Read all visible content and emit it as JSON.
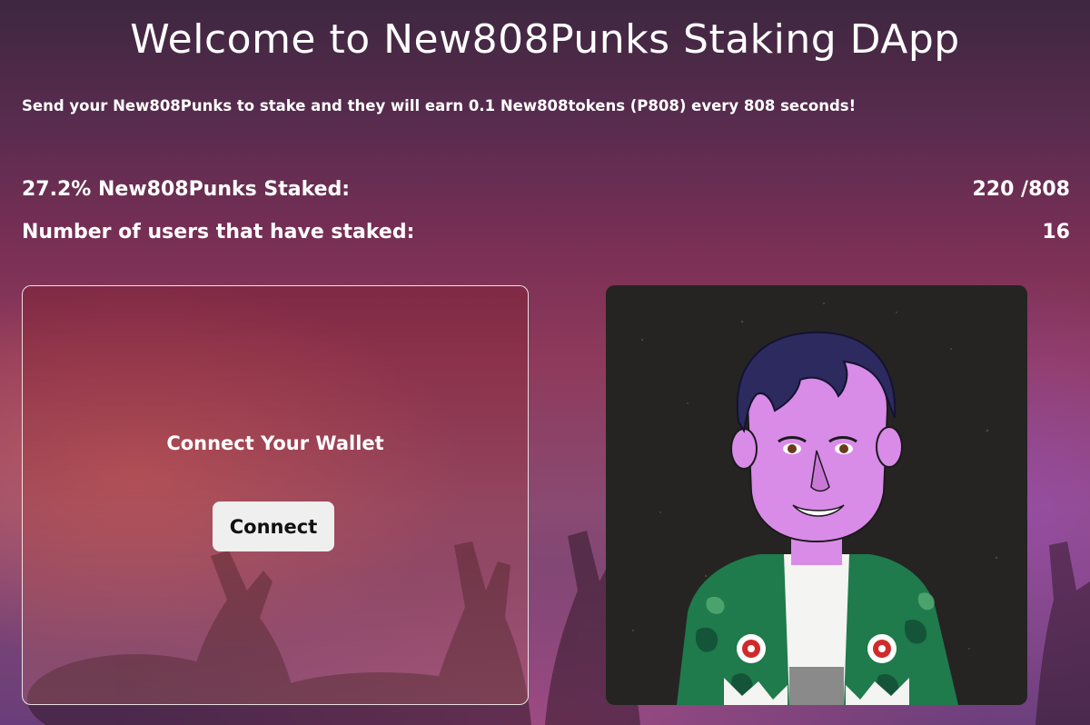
{
  "header": {
    "title": "Welcome to New808Punks Staking DApp",
    "subtitle": "Send your New808Punks to stake and they will earn 0.1 New808tokens (P808) every 808 seconds!"
  },
  "stats": {
    "staked_label": "27.2% New808Punks Staked:",
    "staked_value": "220 /808",
    "users_label": "Number of users that have staked:",
    "users_value": "16"
  },
  "wallet_panel": {
    "heading": "Connect Your Wallet",
    "button_label": "Connect"
  },
  "nft_image": {
    "alt": "New808Punks character avatar"
  },
  "colors": {
    "background_top": "#3e2740",
    "background_mid": "#8e3a5c",
    "button_bg": "#efefef",
    "nft_bg": "#252423",
    "skin": "#d98be8",
    "hair": "#2c2a5e",
    "jacket": "#1f7a4c"
  }
}
